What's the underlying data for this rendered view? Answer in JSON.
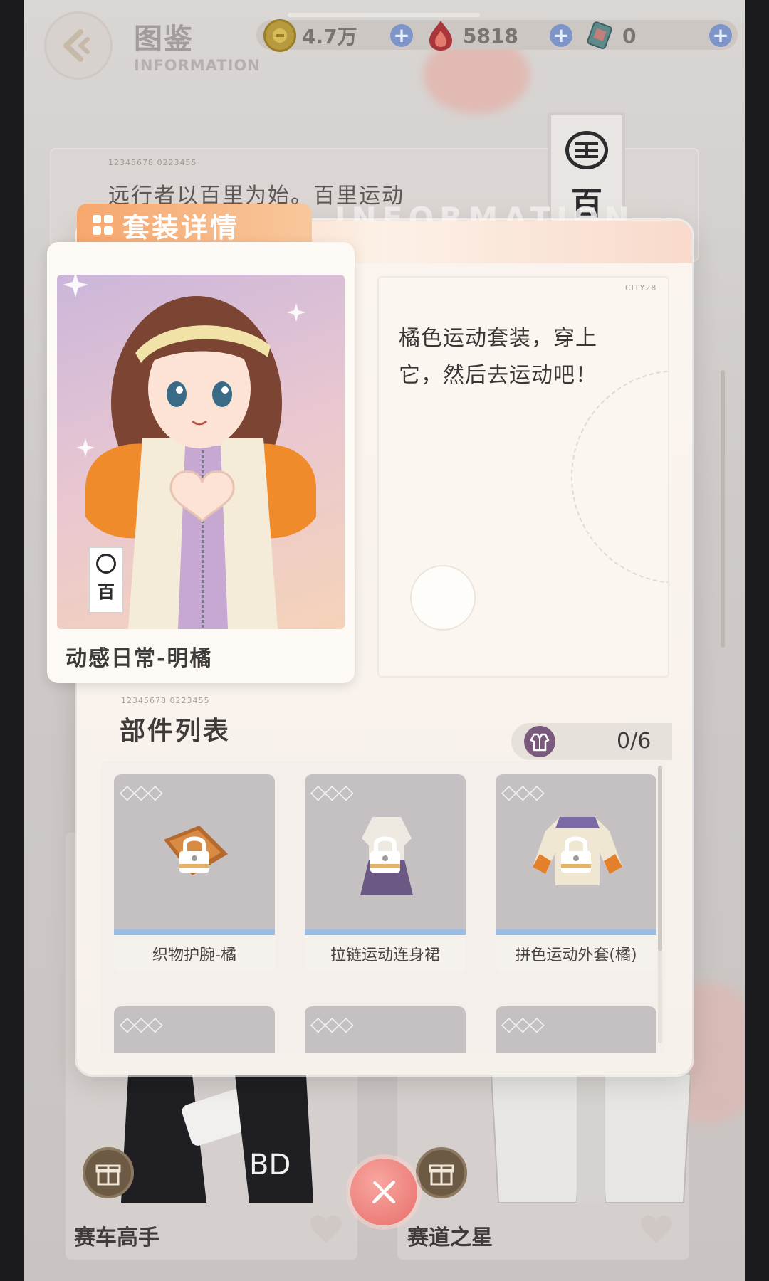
{
  "header": {
    "title": "图鉴",
    "subtitle": "INFORMATION"
  },
  "currencies": [
    {
      "icon": "gold-coin-icon",
      "value": "4.7万"
    },
    {
      "icon": "flame-crystal-icon",
      "value": "5818"
    },
    {
      "icon": "ticket-card-icon",
      "value": "0"
    }
  ],
  "background_card": {
    "text": "远行者以百里为始。百里运动",
    "code": "12345678 0223455",
    "brand_char": "百",
    "deco": "INFORMATION"
  },
  "modal": {
    "title": "套装详情",
    "outfit_name": "动感日常-明橘",
    "description": "橘色运动套装，穿上它，然后去运动吧！",
    "desc_code": "CITY28",
    "brand_char": "百"
  },
  "parts": {
    "code": "12345678 0223455",
    "title": "部件列表",
    "count": "0/6",
    "items": [
      {
        "name": "织物护腕-橘",
        "stars": "◇◇◇"
      },
      {
        "name": "拉链运动连身裙",
        "stars": "◇◇◇"
      },
      {
        "name": "拼色运动外套(橘)",
        "stars": "◇◇◇"
      },
      {
        "name": "",
        "stars": "◇◇◇"
      },
      {
        "name": "",
        "stars": "◇◇◇"
      },
      {
        "name": "",
        "stars": "◇◇◇"
      }
    ]
  },
  "bottom_cards": [
    {
      "name": "赛车高手"
    },
    {
      "name": "赛道之星"
    }
  ],
  "colors": {
    "accent_orange": "#f6a76e",
    "close_red": "#e86e6a",
    "plus_blue": "#7d95c8"
  }
}
